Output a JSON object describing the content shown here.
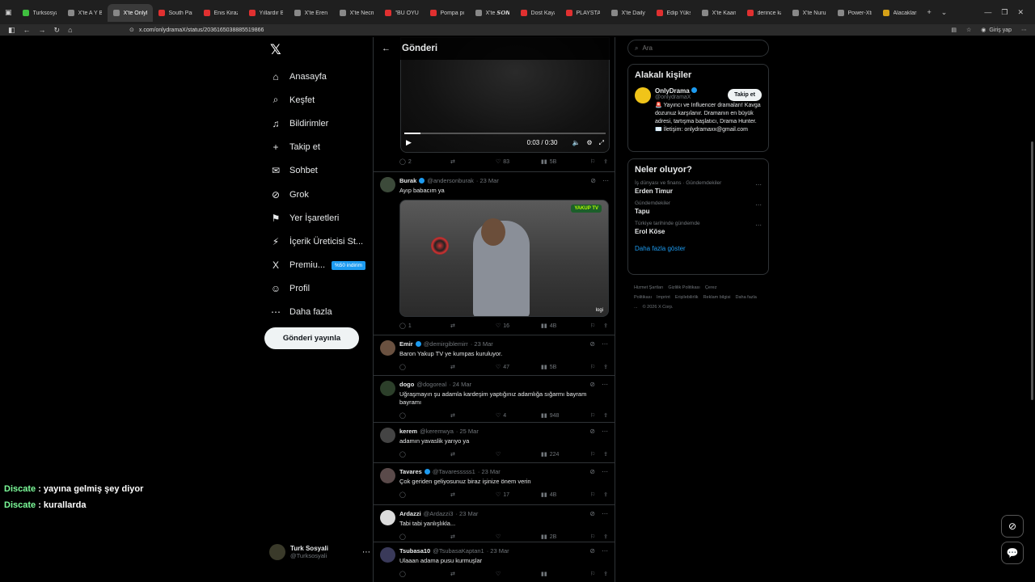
{
  "browser": {
    "tabs": [
      {
        "title": "Turksosyali S",
        "color": "#3fbf3f"
      },
      {
        "title": "X'te A Y B I",
        "color": "#888888"
      },
      {
        "title": "X'te OnlyDr",
        "color": "#888888",
        "active": true
      },
      {
        "title": "South Park S",
        "color": "#e03030"
      },
      {
        "title": "Enis Kirazogl",
        "color": "#e03030"
      },
      {
        "title": "Yıllardır Bekl",
        "color": "#e03030"
      },
      {
        "title": "X'te Eren Car",
        "color": "#888888"
      },
      {
        "title": "X'te Necmi Ta",
        "color": "#888888"
      },
      {
        "title": "\"BU OYUN C",
        "color": "#e03030"
      },
      {
        "title": "Pompa pomp",
        "color": "#e03030"
      },
      {
        "title": "X'te 𝙎𝙊𝙉𝘼𝙎",
        "color": "#888888"
      },
      {
        "title": "Dost Kayaoğ",
        "color": "#e03030"
      },
      {
        "title": "PLAYSTATION",
        "color": "#e03030"
      },
      {
        "title": "X'te Daily Tu",
        "color": "#888888"
      },
      {
        "title": "Edip Yüksel (",
        "color": "#e03030"
      },
      {
        "title": "X'te Kaan Ar",
        "color": "#888888"
      },
      {
        "title": "derince kazar",
        "color": "#e03030"
      },
      {
        "title": "X'te Nurullah",
        "color": "#888888"
      },
      {
        "title": "Power-Xtra P",
        "color": "#888888"
      },
      {
        "title": "Alacaklarını",
        "color": "#d4a017"
      }
    ],
    "url": "x.com/onlydramaX/status/2036165038885519866",
    "login_label": "Giriş yap"
  },
  "nav": {
    "items": [
      {
        "label": "Anasayfa",
        "icon": "⌂"
      },
      {
        "label": "Keşfet",
        "icon": "⌕"
      },
      {
        "label": "Bildirimler",
        "icon": "♫"
      },
      {
        "label": "Takip et",
        "icon": "+"
      },
      {
        "label": "Sohbet",
        "icon": "✉"
      },
      {
        "label": "Grok",
        "icon": "⊘"
      },
      {
        "label": "Yer İşaretleri",
        "icon": "⚑"
      },
      {
        "label": "İçerik Üreticisi St...",
        "icon": "⚡"
      },
      {
        "label": "Premiu...",
        "icon": "X"
      },
      {
        "label": "Profil",
        "icon": "☺"
      },
      {
        "label": "Daha fazla",
        "icon": "⋯"
      }
    ],
    "premium_badge": "%50 indirim",
    "post_button": "Gönderi yayınla",
    "account": {
      "name": "Turk Sosyali",
      "handle": "@Turksosyali"
    }
  },
  "header": {
    "title": "Gönderi"
  },
  "video": {
    "time": "0:03 / 0:30",
    "progress": 0.08,
    "stats": {
      "reply": "2",
      "retweet": "",
      "like": "83",
      "views": "5B"
    }
  },
  "tweets": [
    {
      "name": "Burak",
      "verified": true,
      "handle": "@andersonburak",
      "date": "· 23 Mar",
      "text": "Ayıp babacım ya",
      "stats": {
        "reply": "1",
        "retweet": "",
        "like": "16",
        "views": "4B"
      },
      "avatar": "#3c4a3a",
      "image": {
        "tag": "YAKUP TV",
        "watermark": "logi"
      }
    },
    {
      "name": "Emir",
      "verified": true,
      "handle": "@demirgiblemirr",
      "date": "· 23 Mar",
      "text": "Baron Yakup TV ye kumpas kuruluyor.",
      "stats": {
        "reply": "",
        "retweet": "",
        "like": "47",
        "views": "5B"
      },
      "avatar": "#6a5140"
    },
    {
      "name": "dogo",
      "verified": false,
      "handle": "@dogoreal",
      "date": "· 24 Mar",
      "text": "Uğraşmayın şu adamla kardeşim yaptığınız adamlığa sığarmı bayram bayramı",
      "stats": {
        "reply": "",
        "retweet": "",
        "like": "4",
        "views": "948"
      },
      "avatar": "#2c3f2a"
    },
    {
      "name": "kerem",
      "verified": false,
      "handle": "@keremwya",
      "date": "· 25 Mar",
      "text": "adamın yavaslik yarıyo ya",
      "stats": {
        "reply": "",
        "retweet": "",
        "like": "",
        "views": "224"
      },
      "avatar": "#444444"
    },
    {
      "name": "Tavares",
      "verified": true,
      "handle": "@Tavaresssss1",
      "date": "· 23 Mar",
      "text": "Çok geriden geliyosunuz biraz işinize önem verin",
      "stats": {
        "reply": "",
        "retweet": "",
        "like": "17",
        "views": "4B"
      },
      "avatar": "#5a4a4a"
    },
    {
      "name": "Ardazzi",
      "verified": false,
      "handle": "@Ardazzi3",
      "date": "· 23 Mar",
      "text": "Tabi tabi yanlışlıkla...",
      "stats": {
        "reply": "",
        "retweet": "",
        "like": "",
        "views": "2B"
      },
      "avatar": "#dcdcdc"
    },
    {
      "name": "Tsubasa10",
      "verified": false,
      "handle": "@TsubasaKaptan1",
      "date": "· 23 Mar",
      "text": "Ulaaan adama pusu kurmuşlar",
      "stats": {
        "reply": "",
        "retweet": "",
        "like": "",
        "views": ""
      },
      "avatar": "#3a3a5a"
    }
  ],
  "search": {
    "placeholder": "Ara"
  },
  "related": {
    "title": "Alakalı kişiler",
    "name": "OnlyDrama",
    "handle": "@onlydramaX",
    "follow": "Takip et",
    "bio": "🚨 Yayıncı ve Influencer dramaları! Kavga dozunuz karşılanır. Dramanın en büyük adresi, tartışma başlatıcı, Drama Hunter. ✉️ İletişim: onlydramaxx@gmail.com"
  },
  "trends": {
    "title": "Neler oluyor?",
    "items": [
      {
        "meta": "İş dünyası ve finans · Gündemdekiler",
        "name": "Erden Timur"
      },
      {
        "meta": "Gündemdekiler",
        "name": "Tapu"
      },
      {
        "meta": "Türkiye tarihinde gündemde",
        "name": "Erol Köse"
      }
    ],
    "show_more": "Daha fazla göster"
  },
  "footer": [
    "Hizmet Şartları",
    "Gizlilik Politikası",
    "Çerez Politikası",
    "Imprint",
    "Erişilebilirlik",
    "Reklam bilgisi",
    "Daha fazla ...",
    "© 2026 X Corp."
  ],
  "chat": [
    {
      "user": "Discate",
      "msg": " : yayına gelmiş şey diyor"
    },
    {
      "user": "Discate",
      "msg": " : kurallarda"
    }
  ]
}
